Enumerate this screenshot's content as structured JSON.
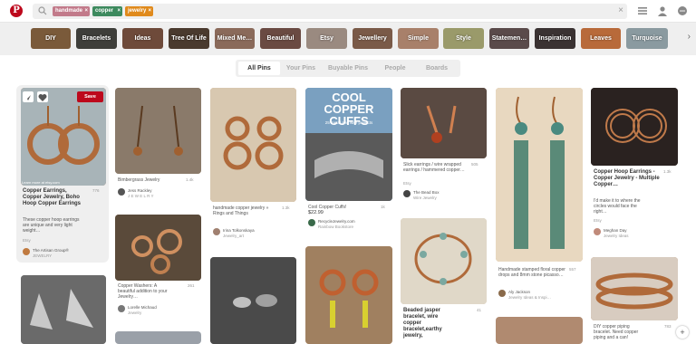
{
  "search": {
    "chips": [
      {
        "label": "handmade",
        "color": "#c27a8a"
      },
      {
        "label": "copper",
        "color": "#3d8a5e"
      },
      {
        "label": "jewelry",
        "color": "#e08a1c"
      }
    ],
    "clear": "×"
  },
  "guides": [
    {
      "label": "DIY",
      "color": "#7a5a3a"
    },
    {
      "label": "Bracelets",
      "color": "#3e3e3a"
    },
    {
      "label": "Ideas",
      "color": "#6e4a3a"
    },
    {
      "label": "Tree Of Life",
      "color": "#4a3a2e"
    },
    {
      "label": "Mixed Me…",
      "color": "#8a6a5a"
    },
    {
      "label": "Beautiful",
      "color": "#6a4a42"
    },
    {
      "label": "Etsy",
      "color": "#9a8a80"
    },
    {
      "label": "Jewellery",
      "color": "#7a5a48"
    },
    {
      "label": "Simple",
      "color": "#a8806a"
    },
    {
      "label": "Style",
      "color": "#9a9a6a"
    },
    {
      "label": "Statemen…",
      "color": "#5a4a4a"
    },
    {
      "label": "Inspiration",
      "color": "#3a3232"
    },
    {
      "label": "Leaves",
      "color": "#b86a3a"
    },
    {
      "label": "Turquoise",
      "color": "#8a9aa0"
    }
  ],
  "tabs": [
    "All Pins",
    "Your Pins",
    "Buyable Pins",
    "People",
    "Boards"
  ],
  "pins": [
    {
      "title": "Copper Earrings, Copper Jewelry, Boho Hoop Copper Earrings",
      "desc": "These copper hoop earrings are unique and very light weight…",
      "count": "776",
      "source": "Etsy",
      "user": "The Artisan Group®",
      "board": "JEWELRY",
      "overlay": "Learn more at etsy.com",
      "save": "Save",
      "img": "#b07a5a"
    },
    {
      "title": "",
      "desc": "Bimbergrass Jewelry",
      "count": "1.4k",
      "user": "Jess Rackley",
      "board": "J E W E L R Y",
      "img": "#8a6a50"
    },
    {
      "title": "",
      "desc": "handmade copper jewelry » Rings and Things",
      "count": "1.3k",
      "user": "Irina Tolkonskaya",
      "board": "Jewelry_art",
      "img": "#c08a60"
    },
    {
      "title": "",
      "desc": "Cool Copper Cuffs!",
      "price": "$22.99",
      "count": "1k",
      "user": "RecycleJewelry.com",
      "board": "Rainbow Bookstore",
      "img": "#4a6a8a",
      "book_title": "COOL COPPER CUFFS",
      "book_sub": "25 metal and wire projects"
    },
    {
      "title": "",
      "desc": "Slick earrings / wire wrapped earrings / hammered copper…",
      "count": "505",
      "source": "Etsy",
      "user": "The Bead Box",
      "board": "Wire Jewelry",
      "img": "#6a4a3a"
    },
    {
      "title": "",
      "desc": "Handmade stamped floral copper drops and 8mm stone picasso…",
      "count": "557",
      "user": "Aly Jackson",
      "board": "Jewelry Ideas & Inspi…",
      "img": "#c8a070"
    },
    {
      "title": "Copper Hoop Earrings - Copper Jewelry - Multiple Copper…",
      "desc": "I'd make it to where the circles would face the right…",
      "count": "1.3k",
      "source": "Etsy",
      "user": "Meghan Day",
      "board": "Jewelry Ideas",
      "img": "#3a2a22"
    },
    {
      "title": "",
      "desc": "Copper Washers: A beautiful addition to your Jewelry…",
      "count": "261",
      "user": "Lorelle Michaud",
      "board": "Jewelry",
      "img": "#7a5a40"
    },
    {
      "title": "Beaded jasper bracelet, wire copper bracelet,earthy jewelry,",
      "desc": "",
      "count": "41",
      "img": "#c8b8a0"
    },
    {
      "title": "",
      "desc": "DIY copper piping bracelet. Need copper piping and a can!",
      "count": "783",
      "img": "#b07a50"
    }
  ]
}
